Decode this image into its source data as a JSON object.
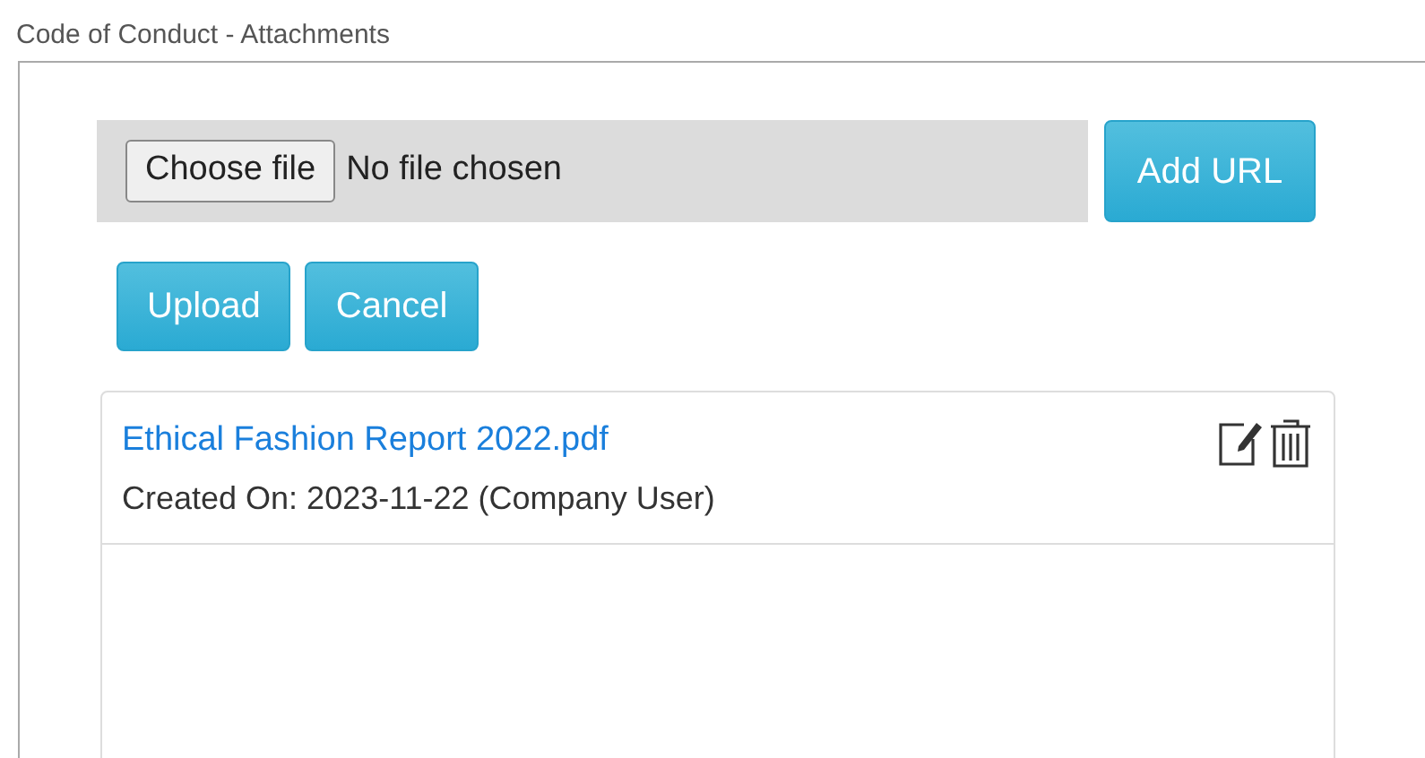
{
  "title": "Code of Conduct - Attachments",
  "file_picker": {
    "button": "Choose file",
    "status": "No file chosen"
  },
  "add_url_button": "Add URL",
  "actions": [
    "Upload",
    "Cancel"
  ],
  "attachments": [
    {
      "name": "Ethical Fashion Report 2022.pdf",
      "meta": "Created On: 2023-11-22 (Company User)"
    }
  ]
}
